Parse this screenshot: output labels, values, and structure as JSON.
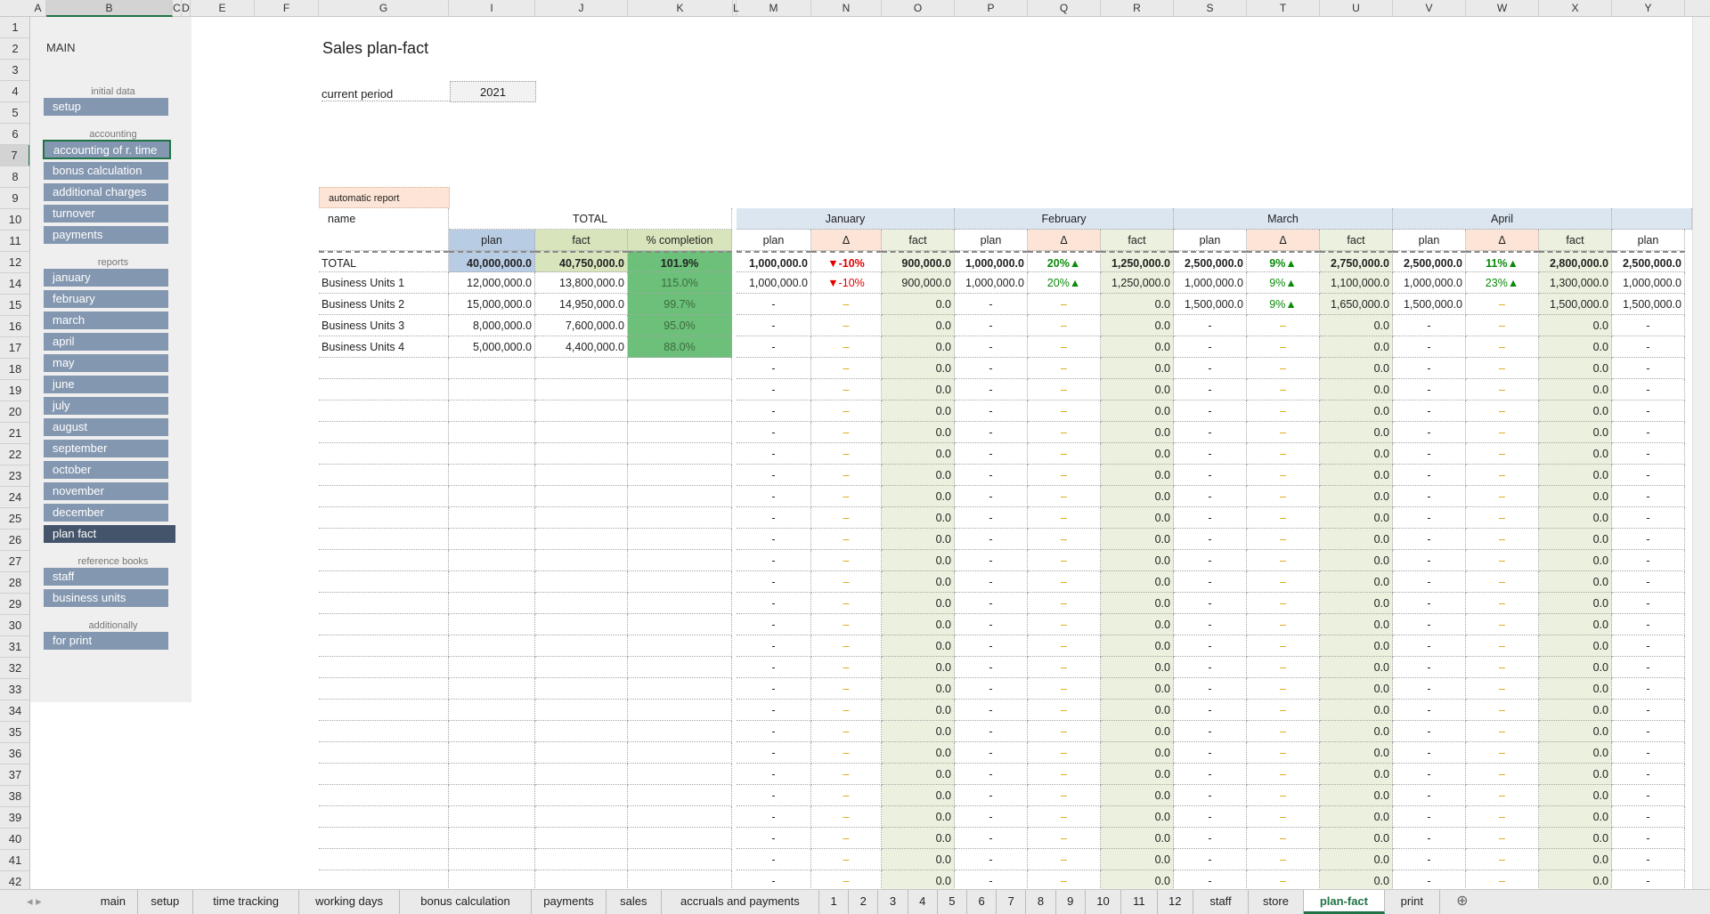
{
  "columns": [
    {
      "id": "A",
      "w": 18
    },
    {
      "id": "B",
      "w": 142
    },
    {
      "id": "C",
      "w": 10
    },
    {
      "id": "D",
      "w": 10
    },
    {
      "id": "E",
      "w": 72
    },
    {
      "id": "F",
      "w": 72
    },
    {
      "id": "G",
      "w": 146
    },
    {
      "id": "I",
      "w": 97
    },
    {
      "id": "J",
      "w": 104
    },
    {
      "id": "K",
      "w": 118
    },
    {
      "id": "L",
      "w": 4
    },
    {
      "id": "M",
      "w": 84
    },
    {
      "id": "N",
      "w": 79
    },
    {
      "id": "O",
      "w": 82
    },
    {
      "id": "P",
      "w": 82
    },
    {
      "id": "Q",
      "w": 82
    },
    {
      "id": "R",
      "w": 82
    },
    {
      "id": "S",
      "w": 82
    },
    {
      "id": "T",
      "w": 82
    },
    {
      "id": "U",
      "w": 82
    },
    {
      "id": "V",
      "w": 82
    },
    {
      "id": "W",
      "w": 82
    },
    {
      "id": "X",
      "w": 82
    },
    {
      "id": "Y",
      "w": 82
    }
  ],
  "rows": [
    "1",
    "2",
    "3",
    "4",
    "5",
    "6",
    "7",
    "8",
    "9",
    "10",
    "11",
    "12",
    "14",
    "15",
    "16",
    "17",
    "18",
    "19",
    "20",
    "21",
    "22",
    "23",
    "24",
    "25",
    "26",
    "27",
    "28",
    "29",
    "30",
    "31",
    "32",
    "33",
    "34",
    "35",
    "36",
    "37",
    "38",
    "39",
    "40",
    "41",
    "42",
    "43"
  ],
  "sidebar": {
    "title": "MAIN",
    "sections": {
      "initial": "initial data",
      "accounting": "accounting",
      "reports": "reports",
      "reference": "reference books",
      "additionally": "additionally"
    },
    "buttons": {
      "setup": "setup",
      "time": "accounting of r. time",
      "bonus": "bonus calculation",
      "charges": "additional charges",
      "turnover": "turnover",
      "payments": "payments",
      "january": "january",
      "february": "february",
      "march": "march",
      "april": "april",
      "may": "may",
      "june": "june",
      "july": "july",
      "august": "august",
      "september": "september",
      "october": "october",
      "november": "november",
      "december": "december",
      "planfact": "plan fact",
      "staff": "staff",
      "units": "business units",
      "print": "for print"
    }
  },
  "sheet": {
    "title": "Sales plan-fact",
    "period_label": "current period",
    "period_value": "2021",
    "auto_report": "automatic report",
    "name_header": "name",
    "total_header": "TOTAL",
    "plan": "plan",
    "fact": "fact",
    "pct": "% completion",
    "delta": "Δ",
    "months": [
      "January",
      "February",
      "March",
      "April"
    ],
    "total_row": {
      "name": "TOTAL",
      "plan": "40,000,000.0",
      "fact": "40,750,000.0",
      "pct": "101.9%",
      "m": [
        [
          "1,000,000.0",
          "▼-10%",
          "900,000.0"
        ],
        [
          "1,000,000.0",
          "20%▲",
          "1,250,000.0"
        ],
        [
          "2,500,000.0",
          "9%▲",
          "2,750,000.0"
        ],
        [
          "2,500,000.0",
          "11%▲",
          "2,800,000.0"
        ],
        [
          "2,500,000.0"
        ]
      ]
    },
    "units": [
      {
        "name": "Business Units 1",
        "plan": "12,000,000.0",
        "fact": "13,800,000.0",
        "pct": "115.0%",
        "m": [
          [
            "1,000,000.0",
            "▼-10%",
            "900,000.0"
          ],
          [
            "1,000,000.0",
            "20%▲",
            "1,250,000.0"
          ],
          [
            "1,000,000.0",
            "9%▲",
            "1,100,000.0"
          ],
          [
            "1,000,000.0",
            "23%▲",
            "1,300,000.0"
          ],
          [
            "1,000,000.0"
          ]
        ]
      },
      {
        "name": "Business Units 2",
        "plan": "15,000,000.0",
        "fact": "14,950,000.0",
        "pct": "99.7%",
        "m": [
          [
            "-",
            "–",
            "0.0"
          ],
          [
            "-",
            "–",
            "0.0"
          ],
          [
            "1,500,000.0",
            "9%▲",
            "1,650,000.0"
          ],
          [
            "1,500,000.0",
            "–",
            "1,500,000.0"
          ],
          [
            "1,500,000.0"
          ]
        ]
      },
      {
        "name": "Business Units 3",
        "plan": "8,000,000.0",
        "fact": "7,600,000.0",
        "pct": "95.0%",
        "m": [
          [
            "-",
            "–",
            "0.0"
          ],
          [
            "-",
            "–",
            "0.0"
          ],
          [
            "-",
            "–",
            "0.0"
          ],
          [
            "-",
            "–",
            "0.0"
          ],
          [
            "-"
          ]
        ]
      },
      {
        "name": "Business Units 4",
        "plan": "5,000,000.0",
        "fact": "4,400,000.0",
        "pct": "88.0%",
        "m": [
          [
            "-",
            "–",
            "0.0"
          ],
          [
            "-",
            "–",
            "0.0"
          ],
          [
            "-",
            "–",
            "0.0"
          ],
          [
            "-",
            "–",
            "0.0"
          ],
          [
            "-"
          ]
        ]
      }
    ],
    "empty_cells": [
      "-",
      "–",
      "0.0"
    ]
  },
  "tabs": [
    "main",
    "setup",
    "time tracking",
    "working days",
    "bonus calculation",
    "payments",
    "sales",
    "accruals and payments",
    "1",
    "2",
    "3",
    "4",
    "5",
    "6",
    "7",
    "8",
    "9",
    "10",
    "11",
    "12",
    "staff",
    "store",
    "plan-fact",
    "print"
  ],
  "active_tab": "plan-fact",
  "colors": {
    "nav": "#8497b0",
    "nav_active": "#44546a",
    "accent": "#217346"
  }
}
